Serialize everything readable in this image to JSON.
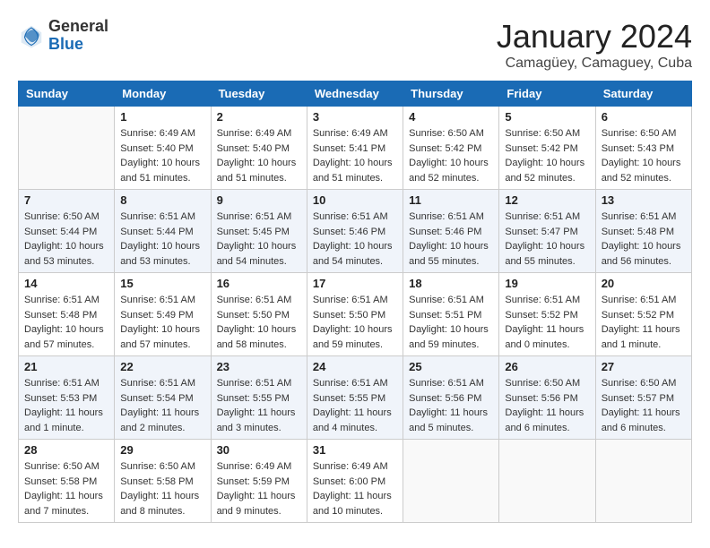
{
  "header": {
    "logo_general": "General",
    "logo_blue": "Blue",
    "month_title": "January 2024",
    "location": "Camagüey, Camaguey, Cuba"
  },
  "days_of_week": [
    "Sunday",
    "Monday",
    "Tuesday",
    "Wednesday",
    "Thursday",
    "Friday",
    "Saturday"
  ],
  "weeks": [
    {
      "alt": false,
      "days": [
        {
          "number": "",
          "info": ""
        },
        {
          "number": "1",
          "info": "Sunrise: 6:49 AM\nSunset: 5:40 PM\nDaylight: 10 hours\nand 51 minutes."
        },
        {
          "number": "2",
          "info": "Sunrise: 6:49 AM\nSunset: 5:40 PM\nDaylight: 10 hours\nand 51 minutes."
        },
        {
          "number": "3",
          "info": "Sunrise: 6:49 AM\nSunset: 5:41 PM\nDaylight: 10 hours\nand 51 minutes."
        },
        {
          "number": "4",
          "info": "Sunrise: 6:50 AM\nSunset: 5:42 PM\nDaylight: 10 hours\nand 52 minutes."
        },
        {
          "number": "5",
          "info": "Sunrise: 6:50 AM\nSunset: 5:42 PM\nDaylight: 10 hours\nand 52 minutes."
        },
        {
          "number": "6",
          "info": "Sunrise: 6:50 AM\nSunset: 5:43 PM\nDaylight: 10 hours\nand 52 minutes."
        }
      ]
    },
    {
      "alt": true,
      "days": [
        {
          "number": "7",
          "info": "Sunrise: 6:50 AM\nSunset: 5:44 PM\nDaylight: 10 hours\nand 53 minutes."
        },
        {
          "number": "8",
          "info": "Sunrise: 6:51 AM\nSunset: 5:44 PM\nDaylight: 10 hours\nand 53 minutes."
        },
        {
          "number": "9",
          "info": "Sunrise: 6:51 AM\nSunset: 5:45 PM\nDaylight: 10 hours\nand 54 minutes."
        },
        {
          "number": "10",
          "info": "Sunrise: 6:51 AM\nSunset: 5:46 PM\nDaylight: 10 hours\nand 54 minutes."
        },
        {
          "number": "11",
          "info": "Sunrise: 6:51 AM\nSunset: 5:46 PM\nDaylight: 10 hours\nand 55 minutes."
        },
        {
          "number": "12",
          "info": "Sunrise: 6:51 AM\nSunset: 5:47 PM\nDaylight: 10 hours\nand 55 minutes."
        },
        {
          "number": "13",
          "info": "Sunrise: 6:51 AM\nSunset: 5:48 PM\nDaylight: 10 hours\nand 56 minutes."
        }
      ]
    },
    {
      "alt": false,
      "days": [
        {
          "number": "14",
          "info": "Sunrise: 6:51 AM\nSunset: 5:48 PM\nDaylight: 10 hours\nand 57 minutes."
        },
        {
          "number": "15",
          "info": "Sunrise: 6:51 AM\nSunset: 5:49 PM\nDaylight: 10 hours\nand 57 minutes."
        },
        {
          "number": "16",
          "info": "Sunrise: 6:51 AM\nSunset: 5:50 PM\nDaylight: 10 hours\nand 58 minutes."
        },
        {
          "number": "17",
          "info": "Sunrise: 6:51 AM\nSunset: 5:50 PM\nDaylight: 10 hours\nand 59 minutes."
        },
        {
          "number": "18",
          "info": "Sunrise: 6:51 AM\nSunset: 5:51 PM\nDaylight: 10 hours\nand 59 minutes."
        },
        {
          "number": "19",
          "info": "Sunrise: 6:51 AM\nSunset: 5:52 PM\nDaylight: 11 hours\nand 0 minutes."
        },
        {
          "number": "20",
          "info": "Sunrise: 6:51 AM\nSunset: 5:52 PM\nDaylight: 11 hours\nand 1 minute."
        }
      ]
    },
    {
      "alt": true,
      "days": [
        {
          "number": "21",
          "info": "Sunrise: 6:51 AM\nSunset: 5:53 PM\nDaylight: 11 hours\nand 1 minute."
        },
        {
          "number": "22",
          "info": "Sunrise: 6:51 AM\nSunset: 5:54 PM\nDaylight: 11 hours\nand 2 minutes."
        },
        {
          "number": "23",
          "info": "Sunrise: 6:51 AM\nSunset: 5:55 PM\nDaylight: 11 hours\nand 3 minutes."
        },
        {
          "number": "24",
          "info": "Sunrise: 6:51 AM\nSunset: 5:55 PM\nDaylight: 11 hours\nand 4 minutes."
        },
        {
          "number": "25",
          "info": "Sunrise: 6:51 AM\nSunset: 5:56 PM\nDaylight: 11 hours\nand 5 minutes."
        },
        {
          "number": "26",
          "info": "Sunrise: 6:50 AM\nSunset: 5:56 PM\nDaylight: 11 hours\nand 6 minutes."
        },
        {
          "number": "27",
          "info": "Sunrise: 6:50 AM\nSunset: 5:57 PM\nDaylight: 11 hours\nand 6 minutes."
        }
      ]
    },
    {
      "alt": false,
      "days": [
        {
          "number": "28",
          "info": "Sunrise: 6:50 AM\nSunset: 5:58 PM\nDaylight: 11 hours\nand 7 minutes."
        },
        {
          "number": "29",
          "info": "Sunrise: 6:50 AM\nSunset: 5:58 PM\nDaylight: 11 hours\nand 8 minutes."
        },
        {
          "number": "30",
          "info": "Sunrise: 6:49 AM\nSunset: 5:59 PM\nDaylight: 11 hours\nand 9 minutes."
        },
        {
          "number": "31",
          "info": "Sunrise: 6:49 AM\nSunset: 6:00 PM\nDaylight: 11 hours\nand 10 minutes."
        },
        {
          "number": "",
          "info": ""
        },
        {
          "number": "",
          "info": ""
        },
        {
          "number": "",
          "info": ""
        }
      ]
    }
  ]
}
